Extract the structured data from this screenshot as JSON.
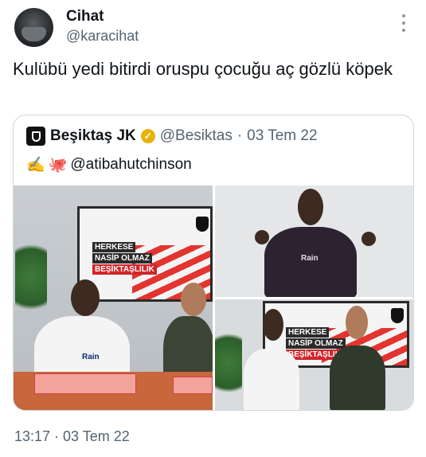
{
  "author": {
    "display_name": "Cihat",
    "handle": "@karacihat"
  },
  "tweet": {
    "text": "Kulübü yedi bitirdi oruspu çocuğu aç gözlü köpek",
    "timestamp": "13:17 · 03 Tem 22"
  },
  "quoted_tweet": {
    "name": "Beşiktaş JK",
    "handle": "@Besiktas",
    "separator": "·",
    "date": "03 Tem 22",
    "text": "@atibahutchinson",
    "emojis": [
      "✍️",
      "🐙"
    ]
  },
  "media_text": {
    "banner_line1": "HERKESE",
    "banner_line2": "NASİP OLMAZ",
    "banner_line3": "BEŞİKTAŞLILIK",
    "sponsor": "Rain"
  },
  "colors": {
    "secondary_text": "#536471",
    "border": "#cfd9de",
    "verified": "#e8b20c"
  },
  "icons": {
    "more": "more-vertical-icon",
    "verified": "verified-badge-icon",
    "logo": "besiktas-logo-icon"
  }
}
